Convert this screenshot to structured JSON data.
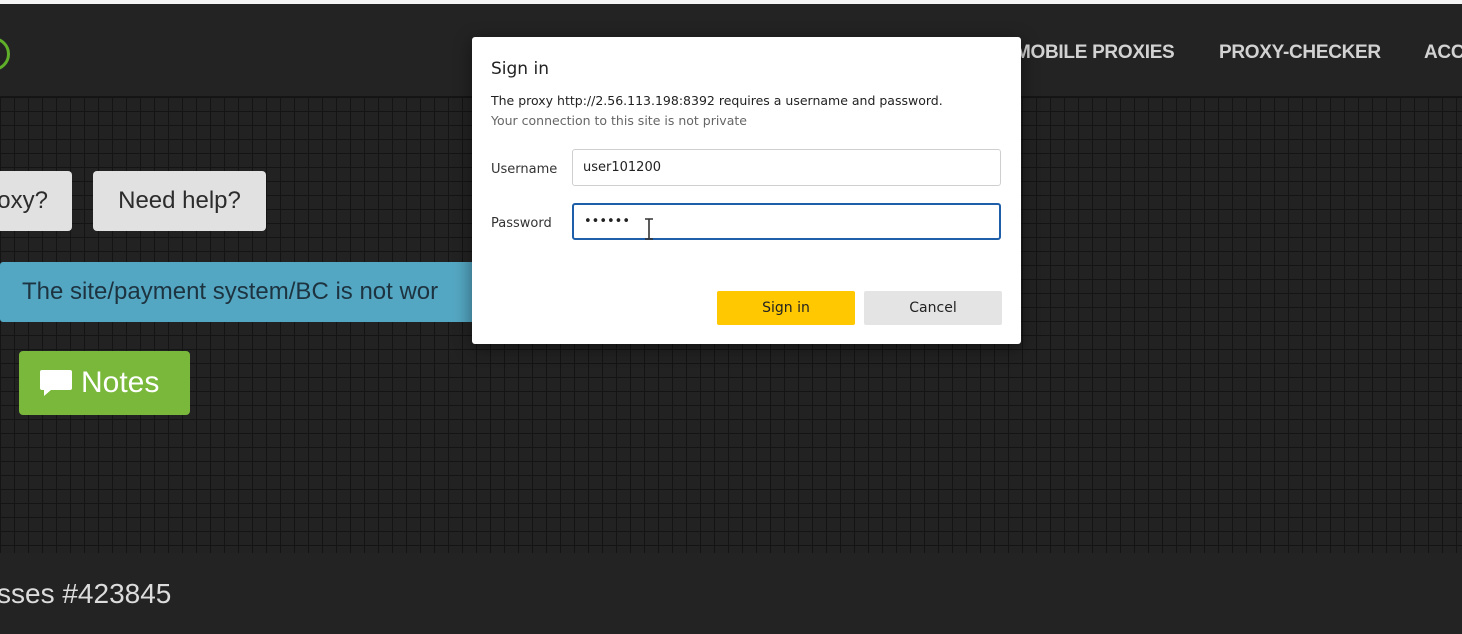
{
  "nav": {
    "links": [
      "MOBILE PROXIES",
      "PROXY-CHECKER",
      "ACC"
    ]
  },
  "page": {
    "btn_proxy": "oxy?",
    "btn_help": "Need help?",
    "info_bar": "The site/payment system/BC is not wor",
    "notes_label": "Notes",
    "footer_text": "sses #423845"
  },
  "dialog": {
    "title": "Sign in",
    "message": "The proxy http://2.56.113.198:8392 requires a username and password.",
    "subtext": "Your connection to this site is not private",
    "username_label": "Username",
    "username_value": "user101200",
    "password_label": "Password",
    "password_value": "••••••",
    "signin_label": "Sign in",
    "cancel_label": "Cancel"
  },
  "colors": {
    "accent_yellow": "#ffc800",
    "notes_green": "#79b83a",
    "info_blue": "#54a7c3",
    "focus_blue": "#1f5ea8"
  },
  "icons": {
    "notes": "comment-icon",
    "logo": "logo-ring-icon",
    "cursor": "text-cursor-icon"
  }
}
